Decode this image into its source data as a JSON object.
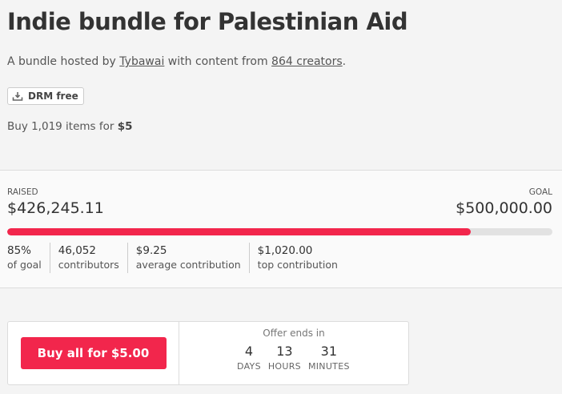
{
  "header": {
    "title": "Indie bundle for Palestinian Aid",
    "subtitle_prefix": "A bundle hosted by",
    "host": "Tybawai",
    "subtitle_middle": "with content from",
    "creators_link": "864 creators",
    "subtitle_suffix": ".",
    "drm_badge": "DRM free",
    "buy_prefix": "Buy 1,019 items for",
    "buy_price": "$5"
  },
  "fundraising": {
    "raised_label": "RAISED",
    "raised_value": "$426,245.11",
    "goal_label": "GOAL",
    "goal_value": "$500,000.00",
    "progress_fraction": 0.85,
    "bar_color": "#f2264c",
    "stats": [
      {
        "value": "85%",
        "label": "of goal"
      },
      {
        "value": "46,052",
        "label": "contributors"
      },
      {
        "value": "$9.25",
        "label": "average contribution"
      },
      {
        "value": "$1,020.00",
        "label": "top contribution"
      }
    ]
  },
  "purchase": {
    "buy_button_label": "Buy all for $5.00",
    "offer_label": "Offer ends in",
    "countdown": [
      {
        "value": "4",
        "unit": "DAYS"
      },
      {
        "value": "13",
        "unit": "HOURS"
      },
      {
        "value": "31",
        "unit": "MINUTES"
      }
    ]
  },
  "icons": {
    "drm": "download-tray-icon"
  }
}
